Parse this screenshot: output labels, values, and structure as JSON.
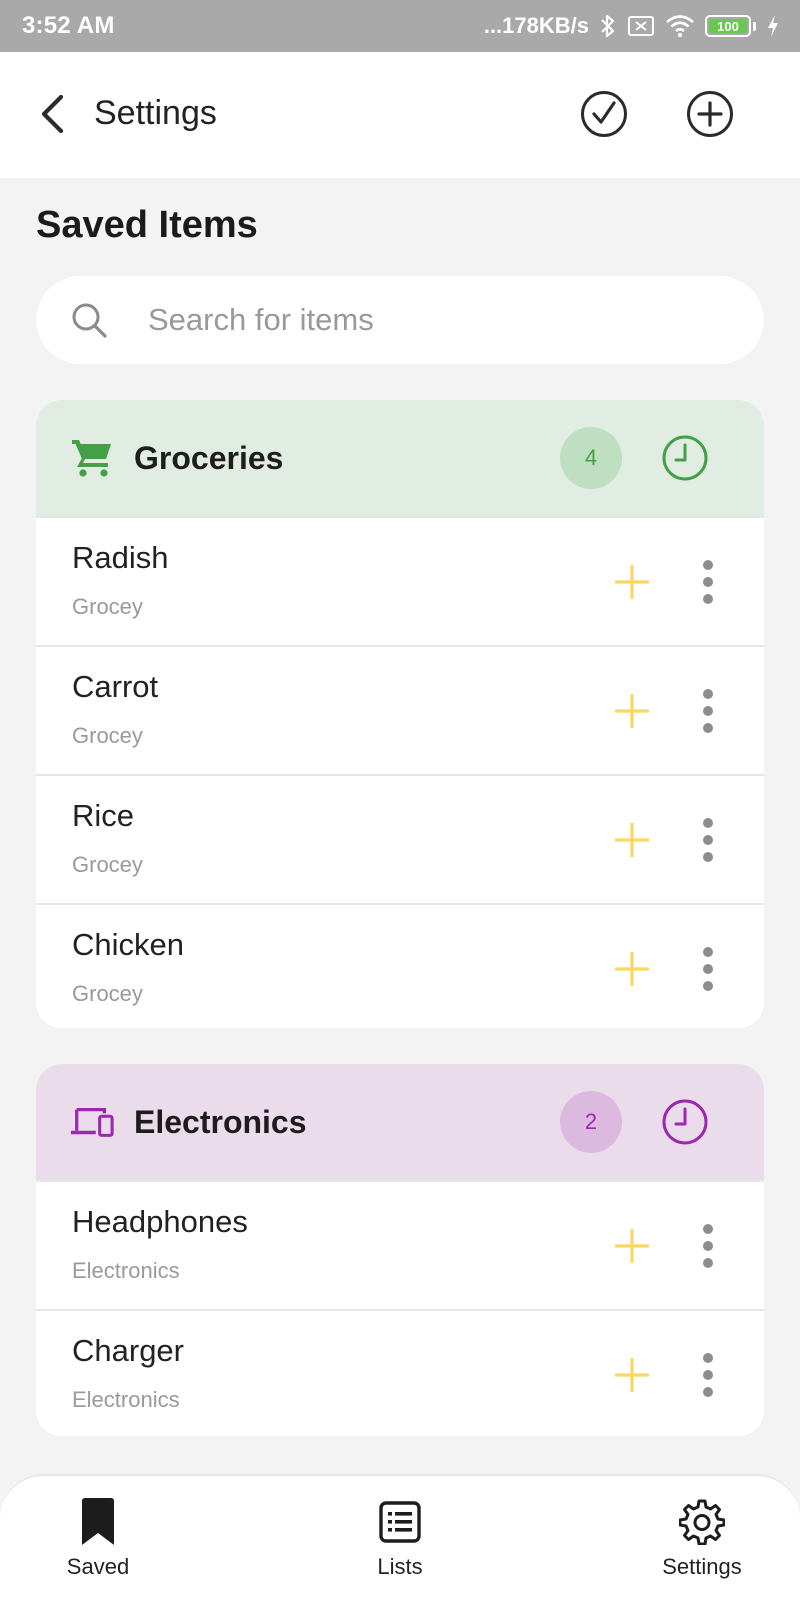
{
  "status_bar": {
    "time": "3:52 AM",
    "network_speed": "...178KB/s",
    "battery": "100"
  },
  "app_bar": {
    "title": "Settings"
  },
  "section_title": "Saved Items",
  "search": {
    "placeholder": "Search for items",
    "value": ""
  },
  "categories": [
    {
      "name": "Groceries",
      "count": "4",
      "icon": "shopping-cart-icon",
      "colors": {
        "header_bg": "#e1ece2",
        "icon": "#43a047",
        "badge_bg": "#bedfc0",
        "badge_text": "#43a047"
      },
      "items": [
        {
          "name": "Radish",
          "category": "Grocey"
        },
        {
          "name": "Carrot",
          "category": "Grocey"
        },
        {
          "name": "Rice",
          "category": "Grocey"
        },
        {
          "name": "Chicken",
          "category": "Grocey"
        }
      ]
    },
    {
      "name": "Electronics",
      "count": "2",
      "icon": "devices-icon",
      "colors": {
        "header_bg": "#ebdcec",
        "icon": "#9c27b0",
        "badge_bg": "#dcbadf",
        "badge_text": "#9c27b0"
      },
      "items": [
        {
          "name": "Headphones",
          "category": "Electronics"
        },
        {
          "name": "Charger",
          "category": "Electronics"
        }
      ]
    }
  ],
  "accent_colors": {
    "add_plus": "#fbd961",
    "more_dots": "#8c8c8c"
  },
  "bottom_nav": {
    "saved_label": "Saved",
    "lists_label": "Lists",
    "settings_label": "Settings"
  }
}
